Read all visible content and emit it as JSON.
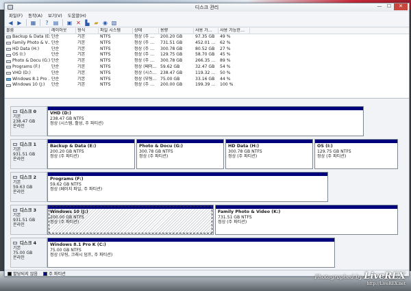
{
  "window": {
    "title": "디스크 관리",
    "minimize": "—",
    "maximize": "☐",
    "close": "✕"
  },
  "menu": [
    "파일(F)",
    "동작(A)",
    "보기(V)",
    "도움말(H)"
  ],
  "toolbar_icons": [
    "back-icon",
    "forward-icon",
    "show-hide-tree-icon",
    "help-icon",
    "properties-icon",
    "delete-icon",
    "open-icon",
    "explore-icon",
    "search-icon",
    "rescan-icon"
  ],
  "volume_table": {
    "headers": [
      "볼륨",
      "레이아웃",
      "형식",
      "파일 시스템",
      "상태",
      "용량",
      "사용 가…",
      "사용 가능한…"
    ],
    "rows": [
      {
        "name": "Backup & Data (E:)",
        "layout": "단순",
        "type": "기본",
        "fs": "NTFS",
        "status": "정상 (주 …",
        "capacity": "200.20 GB",
        "free": "97.35 GB",
        "pct": "49 %"
      },
      {
        "name": "Family Photo & V…",
        "layout": "단순",
        "type": "기본",
        "fs": "NTFS",
        "status": "정상 (주 …",
        "capacity": "731.51 GB",
        "free": "452.01 …",
        "pct": "62 %"
      },
      {
        "name": "HD Data (H:)",
        "layout": "단순",
        "type": "기본",
        "fs": "NTFS",
        "status": "정상 (주 …",
        "capacity": "300.78 GB",
        "free": "80.52 GB",
        "pct": "27 %"
      },
      {
        "name": "OS (I:)",
        "layout": "단순",
        "type": "기본",
        "fs": "NTFS",
        "status": "정상 (주 …",
        "capacity": "129.75 GB",
        "free": "58.70 GB",
        "pct": "45 %"
      },
      {
        "name": "Photo & Docu (G:)",
        "layout": "단순",
        "type": "기본",
        "fs": "NTFS",
        "status": "정상 (주 …",
        "capacity": "300.78 GB",
        "free": "266.35 …",
        "pct": "89 %"
      },
      {
        "name": "Programs (F:)",
        "layout": "단순",
        "type": "기본",
        "fs": "NTFS",
        "status": "정상 (페이…",
        "capacity": "59.62 GB",
        "free": "32.47 GB",
        "pct": "54 %"
      },
      {
        "name": "VHD (D:)",
        "layout": "단순",
        "type": "기본",
        "fs": "NTFS",
        "status": "정상 (시스…",
        "capacity": "238.47 GB",
        "free": "119.32 …",
        "pct": "50 %"
      },
      {
        "name": "Windows 8.1 Pro …",
        "layout": "단순",
        "type": "기본",
        "fs": "NTFS",
        "status": "정상 (부팅…",
        "capacity": "75.00 GB",
        "free": "33.16 GB",
        "pct": "44 %"
      },
      {
        "name": "Windows 10 (J:)",
        "layout": "단순",
        "type": "기본",
        "fs": "NTFS",
        "status": "정상 (주 …",
        "capacity": "200.00 GB",
        "free": "199.39 …",
        "pct": "100 %"
      }
    ]
  },
  "disks": [
    {
      "label": "디스크 0",
      "kind": "기본",
      "size": "238.47 GB",
      "state": "온라인",
      "partitions": [
        {
          "name": "VHD  (D:)",
          "size": "238.47 GB NTFS",
          "status": "정상 (시스템, 활성, 주 파티션)"
        }
      ]
    },
    {
      "label": "디스크 1",
      "kind": "기본",
      "size": "931.51 GB",
      "state": "온라인",
      "partitions": [
        {
          "name": "Backup & Data  (E:)",
          "size": "200.20 GB NTFS",
          "status": "정상 (주 파티션)"
        },
        {
          "name": "Photo & Docu  (G:)",
          "size": "300.78 GB NTFS",
          "status": "정상 (주 파티션)"
        },
        {
          "name": "HD Data  (H:)",
          "size": "300.78 GB NTFS",
          "status": "정상 (주 파티션)"
        },
        {
          "name": "OS  (I:)",
          "size": "129.75 GB NTFS",
          "status": "정상 (주 파티션)"
        }
      ]
    },
    {
      "label": "디스크 2",
      "kind": "기본",
      "size": "59.63 GB",
      "state": "온라인",
      "partitions": [
        {
          "name": "Programs  (F:)",
          "size": "59.62 GB NTFS",
          "status": "정상 (페이지 파일, 주 파티션)"
        }
      ]
    },
    {
      "label": "디스크 3",
      "kind": "기본",
      "size": "931.51 GB",
      "state": "온라인",
      "partitions": [
        {
          "name": "Windows 10  (J:)",
          "size": "200.00 GB NTFS",
          "status": "정상 (주 파티션)"
        },
        {
          "name": "Family Photo & Video  (K:)",
          "size": "731.51 GB NTFS",
          "status": "정상 (주 파티션)"
        }
      ]
    },
    {
      "label": "디스크 4",
      "kind": "기본",
      "size": "75.00 GB",
      "state": "온라인",
      "partitions": [
        {
          "name": "Windows 8.1 Pro K  (C:)",
          "size": "75.00 GB NTFS",
          "status": "정상 (부팅, 크래시 덤프, 주 파티션)"
        }
      ]
    }
  ],
  "legend": [
    {
      "label": "할당되지 않음",
      "color": "#000000"
    },
    {
      "label": "주 파티션",
      "color": "#00007c"
    }
  ],
  "watermark": {
    "prefix": "Photographed by",
    "brand": "LiveREX",
    "url": "http://LiveREX.net"
  }
}
